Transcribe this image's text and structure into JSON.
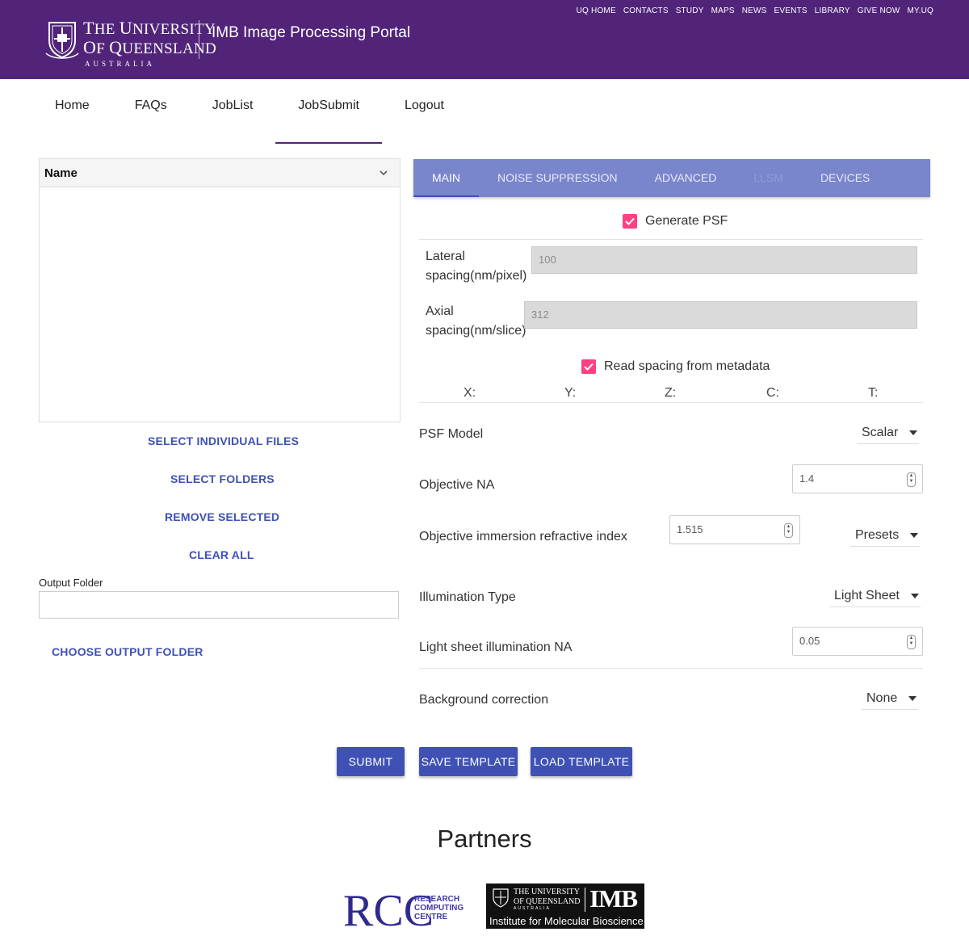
{
  "header": {
    "utility_links": [
      "UQ HOME",
      "CONTACTS",
      "STUDY",
      "MAPS",
      "NEWS",
      "EVENTS",
      "LIBRARY",
      "GIVE NOW",
      "MY.UQ"
    ],
    "uq_logo": {
      "line1_cap": "T",
      "line1_rest": "HE ",
      "line1_cap2": "U",
      "line1_rest2": "NIVERSITY",
      "line2_cap": "O",
      "line2_rest": "F ",
      "line2_cap2": "Q",
      "line2_rest2": "UEENSLAND",
      "line3": "AUSTRALIA"
    },
    "portal_title": "IMB Image Processing Portal"
  },
  "nav": {
    "items": [
      "Home",
      "FAQs",
      "JobList",
      "JobSubmit",
      "Logout"
    ],
    "active": "JobSubmit"
  },
  "file_panel": {
    "column_header": "Name",
    "select_files": "SELECT INDIVIDUAL FILES",
    "select_folders": "SELECT FOLDERS",
    "remove_selected": "REMOVE SELECTED",
    "clear_all": "CLEAR ALL",
    "output_folder_label": "Output Folder",
    "output_folder_value": "",
    "choose_output_folder": "CHOOSE OUTPUT FOLDER"
  },
  "tabs": {
    "items": [
      "MAIN",
      "NOISE SUPPRESSION",
      "ADVANCED",
      "LLSM",
      "DEVICES"
    ],
    "active": "MAIN",
    "disabled": [
      "LLSM"
    ]
  },
  "main_form": {
    "generate_psf": {
      "label": "Generate PSF",
      "checked": true
    },
    "lateral_spacing": {
      "label_line1": "Lateral",
      "label_line2": "spacing(nm/pixel)",
      "value": "100"
    },
    "axial_spacing": {
      "label_line1": "Axial",
      "label_line2": "spacing(nm/slice)",
      "value": "312"
    },
    "read_metadata": {
      "label": "Read spacing from metadata",
      "checked": true
    },
    "axes": [
      "X:",
      "Y:",
      "Z:",
      "C:",
      "T:"
    ],
    "psf_model": {
      "label": "PSF Model",
      "value": "Scalar"
    },
    "objective_na": {
      "label": "Objective NA",
      "value": "1.4"
    },
    "refractive_index": {
      "label": "Objective immersion refractive index",
      "value": "1.515",
      "presets": "Presets"
    },
    "illumination_type": {
      "label": "Illumination Type",
      "value": "Light Sheet"
    },
    "light_sheet_na": {
      "label": "Light sheet illumination NA",
      "value": "0.05"
    },
    "background_correction": {
      "label": "Background correction",
      "value": "None"
    }
  },
  "actions": {
    "submit": "SUBMIT",
    "save_template": "SAVE TEMPLATE",
    "load_template": "LOAD TEMPLATE"
  },
  "partners": {
    "title": "Partners",
    "rcc": {
      "initials": "RCC",
      "line1": "RESEARCH",
      "line2": "COMPUTING",
      "line3": "CENTRE"
    },
    "imb": {
      "line1": "THE UNIVERSITY",
      "line2": "OF QUEENSLAND",
      "line3": "AUSTRALIA",
      "mark": "IMB",
      "subtitle": "Institute for Molecular Bioscience"
    }
  },
  "colors": {
    "uq_purple": "#51247a",
    "tab_bar": "#7986cb",
    "primary": "#3f51b5",
    "checkbox": "#ff4081"
  }
}
